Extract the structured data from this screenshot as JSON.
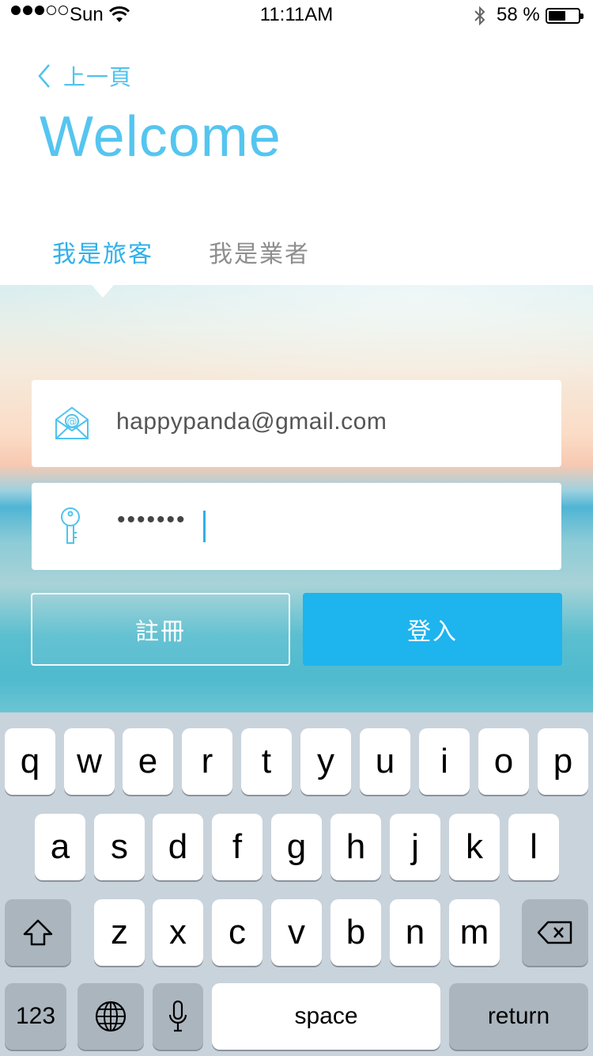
{
  "status_bar": {
    "carrier": "Sun",
    "time": "11:11AM",
    "battery_percent": "58 %",
    "battery_level": 0.58,
    "signal_bars_filled": 3,
    "signal_bars_total": 5
  },
  "header": {
    "back_label": "上一頁",
    "title": "Welcome"
  },
  "tabs": [
    {
      "label": "我是旅客",
      "active": true
    },
    {
      "label": "我是業者",
      "active": false
    }
  ],
  "form": {
    "email_value": "happypanda@gmail.com",
    "password_value": "•••••••",
    "register_label": "註冊",
    "login_label": "登入"
  },
  "colors": {
    "accent": "#1eb4ee",
    "title": "#55c5ef",
    "inactive_tab": "#8e8e8e"
  },
  "keyboard": {
    "row1": [
      "q",
      "w",
      "e",
      "r",
      "t",
      "y",
      "u",
      "i",
      "o",
      "p"
    ],
    "row2": [
      "a",
      "s",
      "d",
      "f",
      "g",
      "h",
      "j",
      "k",
      "l"
    ],
    "row3": [
      "z",
      "x",
      "c",
      "v",
      "b",
      "n",
      "m"
    ],
    "numbers_label": "123",
    "space_label": "space",
    "return_label": "return",
    "icons": [
      "shift-icon",
      "backspace-icon",
      "globe-icon",
      "microphone-icon"
    ]
  }
}
